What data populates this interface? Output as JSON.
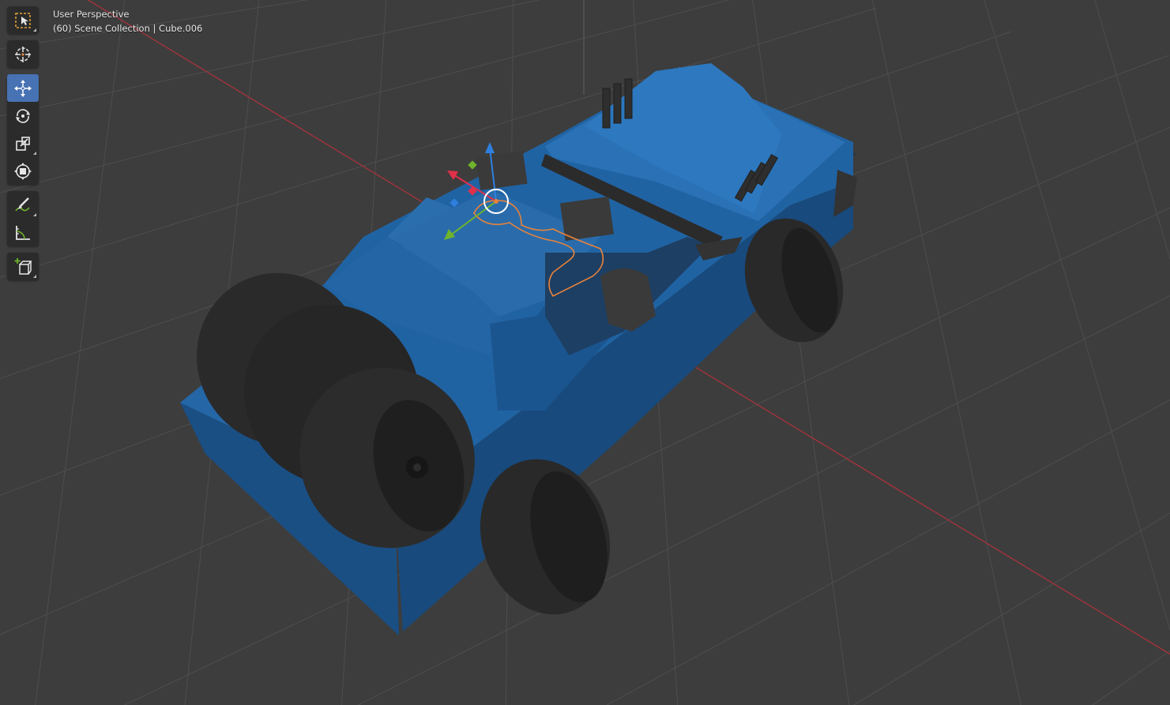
{
  "viewport": {
    "view_name": "User Perspective",
    "collection_info": "(60) Scene Collection | Cube.006"
  },
  "toolbar": {
    "tools": [
      {
        "name": "select-box",
        "icon": "select-box-icon",
        "active": false
      },
      {
        "name": "cursor",
        "icon": "cursor-icon",
        "active": false
      },
      {
        "name": "move",
        "icon": "move-icon",
        "active": true
      },
      {
        "name": "rotate",
        "icon": "rotate-icon",
        "active": false
      },
      {
        "name": "scale",
        "icon": "scale-icon",
        "active": false
      },
      {
        "name": "transform",
        "icon": "transform-icon",
        "active": false
      },
      {
        "name": "annotate",
        "icon": "annotate-icon",
        "active": false
      },
      {
        "name": "measure",
        "icon": "measure-icon",
        "active": false
      },
      {
        "name": "add-cube",
        "icon": "add-cube-icon",
        "active": false
      }
    ]
  },
  "colors": {
    "background": "#3d3d3d",
    "grid": "#4e4e4e",
    "x_axis": "#a2333c",
    "car_body": "#1f5c96",
    "tire": "#2a2a2a",
    "selection_outline": "#e8823a",
    "active_tool": "#4772b3",
    "gizmo_x": "#e0304a",
    "gizmo_y": "#6fb42c",
    "gizmo_z": "#2f7fe0"
  }
}
